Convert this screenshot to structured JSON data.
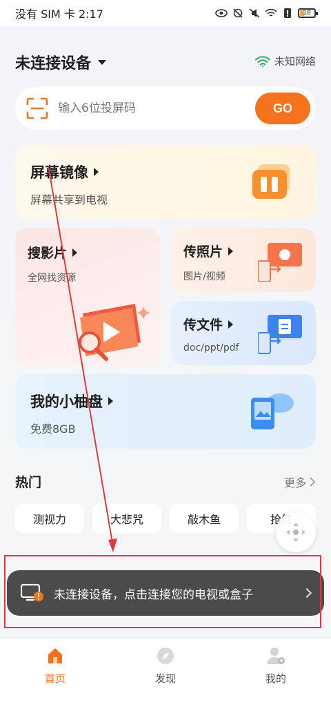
{
  "status_bar": {
    "carrier_time": "没有 SIM 卡 2:17",
    "battery": "18"
  },
  "header": {
    "device_title": "未连接设备",
    "network_label": "未知网络"
  },
  "code_entry": {
    "placeholder": "输入6位投屏码",
    "go_label": "GO"
  },
  "cards": {
    "mirror": {
      "title": "屏幕镜像",
      "subtitle": "屏幕共享到电视"
    },
    "search_video": {
      "title": "搜影片",
      "subtitle": "全网找资源"
    },
    "photo": {
      "title": "传照片",
      "subtitle": "图片/视频"
    },
    "file": {
      "title": "传文件",
      "subtitle": "doc/ppt/pdf"
    },
    "pan": {
      "title": "我的小柚盘",
      "subtitle": "免费8GB"
    }
  },
  "hot": {
    "title": "热门",
    "more_label": "更多",
    "items": [
      "测视力",
      "大悲咒",
      "敲木鱼",
      "抢红"
    ]
  },
  "toast": {
    "text": "未连接设备，点击连接您的电视或盒子"
  },
  "tabbar": {
    "items": [
      "首页",
      "发现",
      "我的"
    ]
  },
  "colors": {
    "accent": "#f5731d",
    "annotation": "#e03a3a"
  }
}
